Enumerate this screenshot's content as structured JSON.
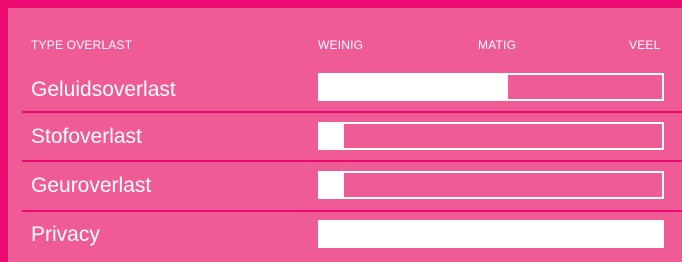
{
  "header": {
    "type_label": "TYPE OVERLAST",
    "scale": [
      "WEINIG",
      "MATIG",
      "VEEL"
    ]
  },
  "colors": {
    "frame": "#ec0a70",
    "panel": "#ef5b95",
    "bar": "#ffffff"
  },
  "chart_data": {
    "type": "bar",
    "orientation": "horizontal",
    "categories": [
      "Geluidsoverlast",
      "Stofoverlast",
      "Geuroverlast",
      "Privacy"
    ],
    "values": [
      0.55,
      0.07,
      0.07,
      1.0
    ],
    "xlim": [
      0,
      1
    ],
    "scale_labels": [
      "WEINIG",
      "MATIG",
      "VEEL"
    ],
    "title": "",
    "xlabel": "",
    "ylabel": "TYPE OVERLAST"
  }
}
